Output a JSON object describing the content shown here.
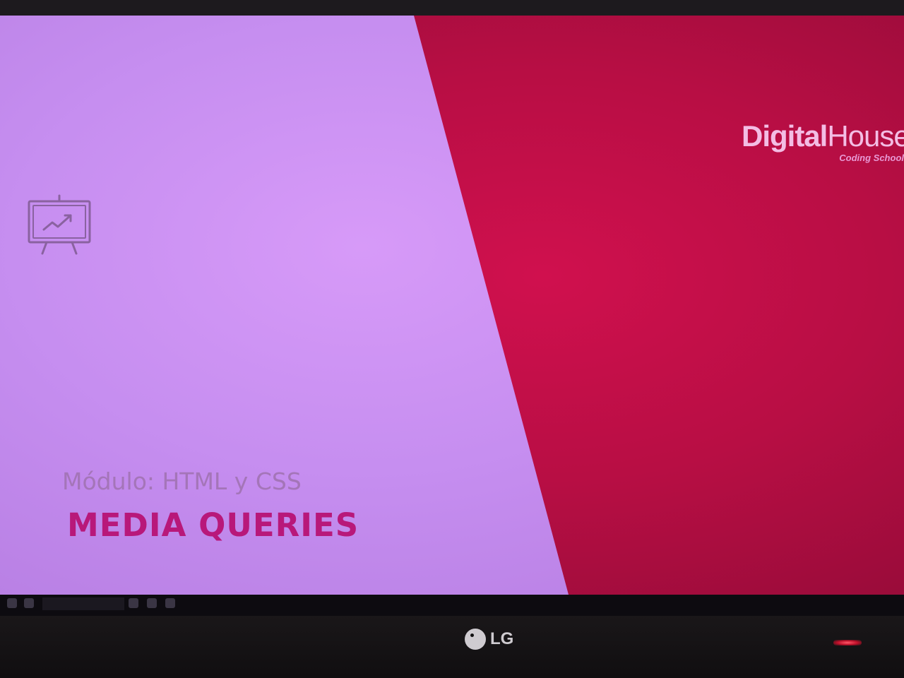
{
  "logo": {
    "brand_bold": "Digital",
    "brand_light": "House",
    "tagline": "Coding School"
  },
  "slide": {
    "module_label": "Módulo: HTML y CSS",
    "title": "MEDIA QUERIES",
    "icon": "presentation-chart-icon"
  },
  "monitor": {
    "brand": "LG"
  },
  "colors": {
    "left_panel": "#c98ef2",
    "right_panel": "#c0104a",
    "title": "#b8187a",
    "module_label": "#a475b8"
  }
}
